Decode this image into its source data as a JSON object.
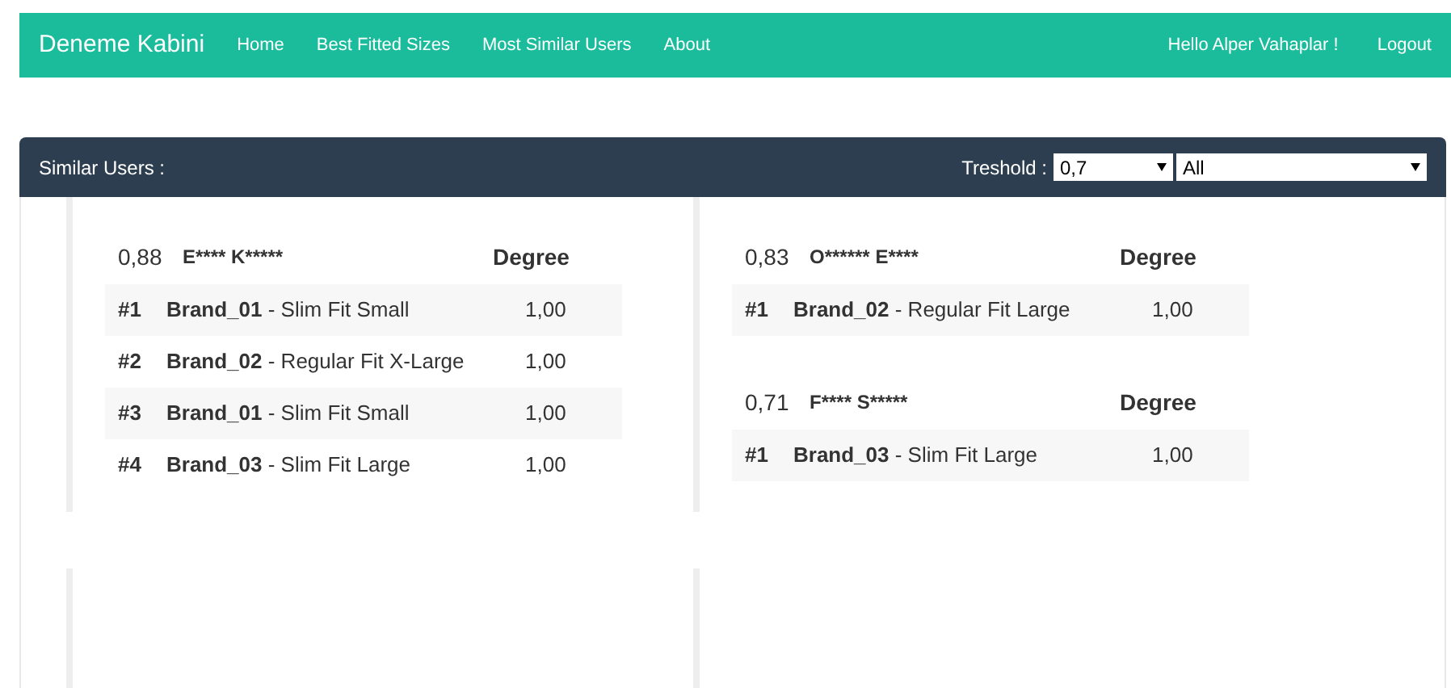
{
  "navbar": {
    "brand": "Deneme Kabini",
    "links": [
      {
        "label": "Home"
      },
      {
        "label": "Best Fitted Sizes"
      },
      {
        "label": "Most Similar Users"
      },
      {
        "label": "About"
      }
    ],
    "greeting": "Hello Alper Vahaplar !",
    "logout": "Logout"
  },
  "panel": {
    "title": "Similar Users :",
    "threshold_label": "Treshold :",
    "threshold_value": "0,7",
    "filter_value": "All",
    "columns": [
      {
        "users": [
          {
            "score": "0,88",
            "name": "E**** K*****",
            "degree_header": "Degree",
            "items": [
              {
                "rank": "#1",
                "product": "**Brand_01** - Slim Fit Small",
                "degree": "1,00"
              },
              {
                "rank": "#2",
                "product": "**Brand_02** - Regular Fit X-Large",
                "degree": "1,00"
              },
              {
                "rank": "#3",
                "product": "**Brand_01** - Slim Fit Small",
                "degree": "1,00"
              },
              {
                "rank": "#4",
                "product": "**Brand_03** - Slim Fit Large",
                "degree": "1,00"
              }
            ]
          }
        ]
      },
      {
        "users": [
          {
            "score": "0,83",
            "name": "O****** E****",
            "degree_header": "Degree",
            "items": [
              {
                "rank": "#1",
                "product": "**Brand_02** - Regular Fit Large",
                "degree": "1,00"
              }
            ]
          },
          {
            "score": "0,71",
            "name": "F**** S*****",
            "degree_header": "Degree",
            "items": [
              {
                "rank": "#1",
                "product": "**Brand_03** - Slim Fit Large",
                "degree": "1,00"
              }
            ]
          }
        ]
      }
    ]
  }
}
